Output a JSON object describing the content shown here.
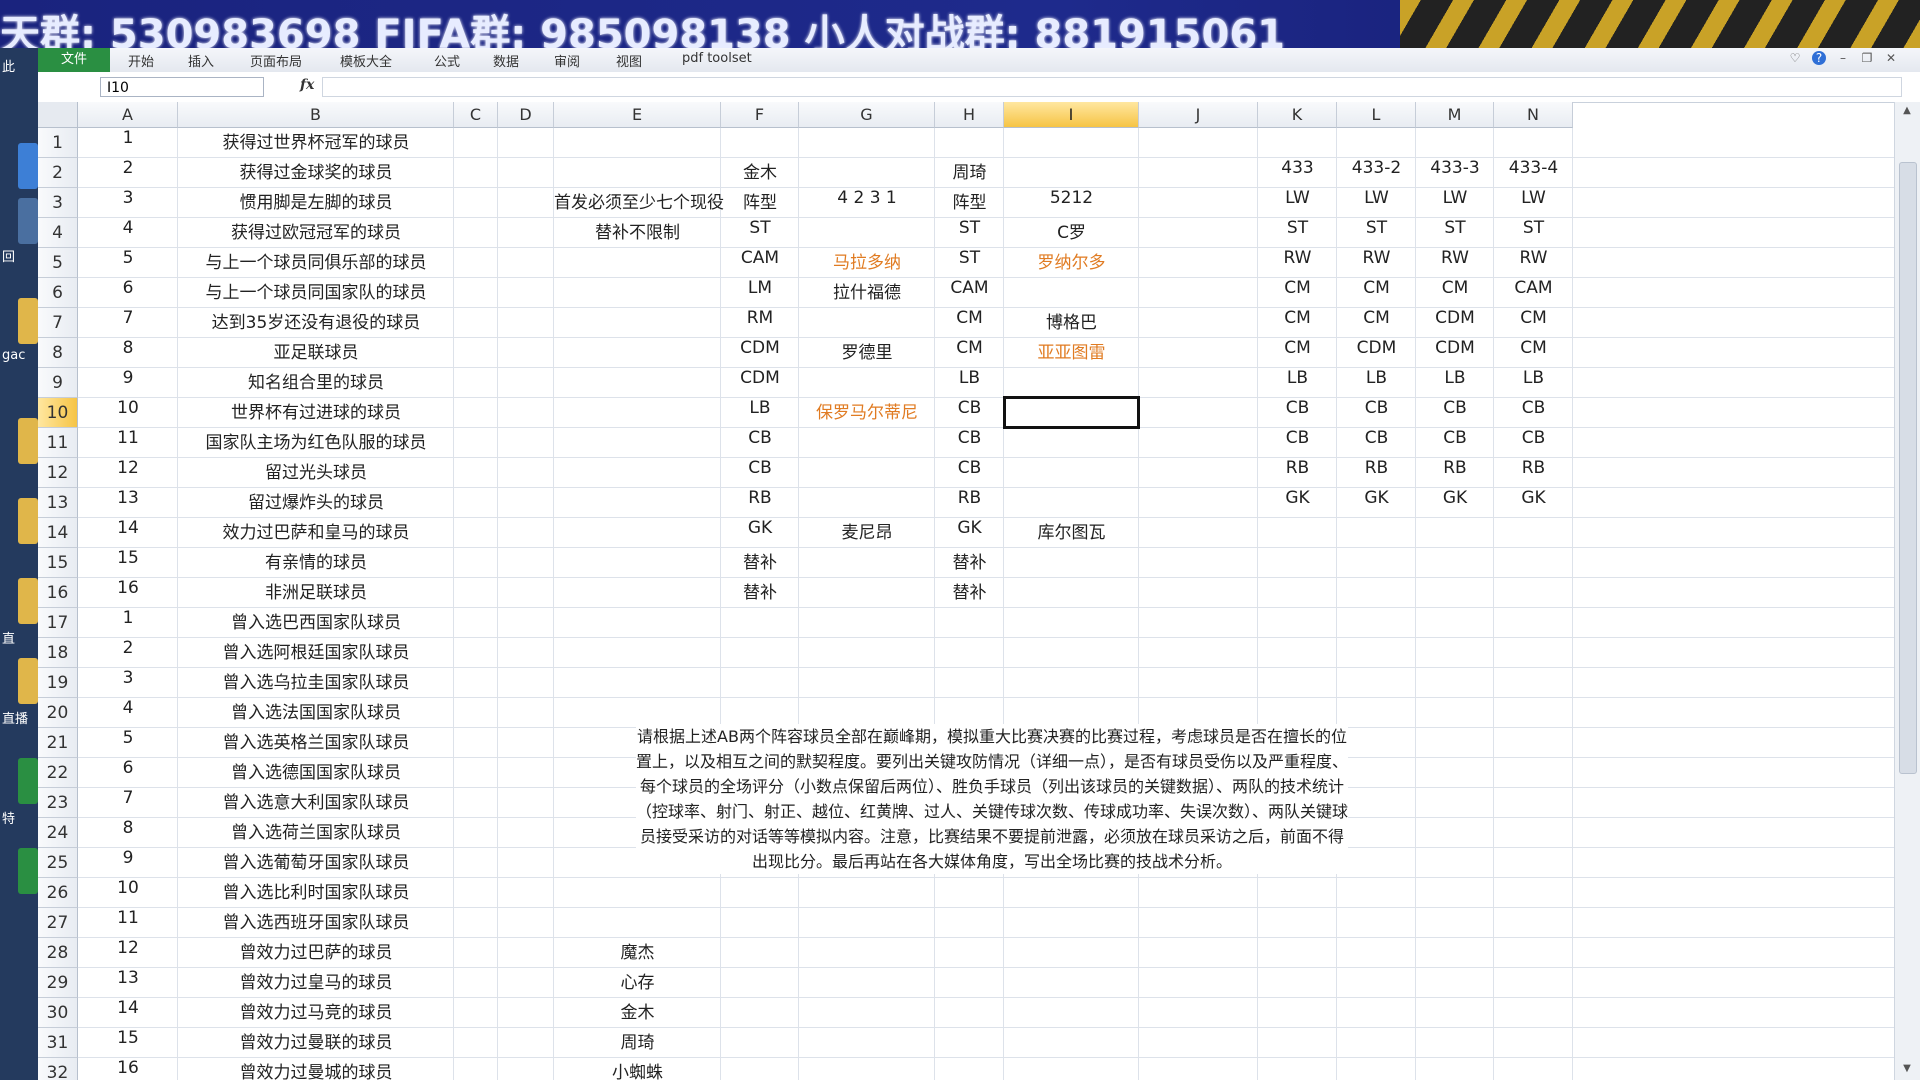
{
  "banner": {
    "text": "天群: 530983698   FIFA群: 985098138   小人对战群: 881915061"
  },
  "desktop": {
    "labels": [
      "此",
      "回",
      "gac",
      "直",
      "直播",
      "特",
      "X"
    ]
  },
  "ribbon": {
    "file_tab": "文件",
    "menus": [
      "开始",
      "插入",
      "页面布局",
      "模板大全",
      "公式",
      "数据",
      "审阅",
      "视图",
      "pdf toolset"
    ]
  },
  "formula": {
    "name_box": "I10",
    "fx": "fx",
    "value": ""
  },
  "columns": [
    "A",
    "B",
    "C",
    "D",
    "E",
    "F",
    "G",
    "H",
    "I",
    "J",
    "K",
    "L",
    "M",
    "N"
  ],
  "rows": [
    "1",
    "2",
    "3",
    "4",
    "5",
    "6",
    "7",
    "8",
    "9",
    "10",
    "11",
    "12",
    "13",
    "14",
    "15",
    "16",
    "17",
    "18",
    "19",
    "20",
    "21",
    "22",
    "23",
    "24",
    "25",
    "26",
    "27",
    "28",
    "29",
    "30",
    "31",
    "32"
  ],
  "selected": {
    "col": "I",
    "row": "10"
  },
  "col_a": [
    "1",
    "2",
    "3",
    "4",
    "5",
    "6",
    "7",
    "8",
    "9",
    "10",
    "11",
    "12",
    "13",
    "14",
    "15",
    "16",
    "1",
    "2",
    "3",
    "4",
    "5",
    "6",
    "7",
    "8",
    "9",
    "10",
    "11",
    "12",
    "13",
    "14",
    "15",
    "16"
  ],
  "col_b": [
    "获得过世界杯冠军的球员",
    "获得过金球奖的球员",
    "惯用脚是左脚的球员",
    "获得过欧冠冠军的球员",
    "与上一个球员同俱乐部的球员",
    "与上一个球员同国家队的球员",
    "达到35岁还没有退役的球员",
    "亚足联球员",
    "知名组合里的球员",
    "世界杯有过进球的球员",
    "国家队主场为红色队服的球员",
    "留过光头球员",
    "留过爆炸头的球员",
    "效力过巴萨和皇马的球员",
    "有亲情的球员",
    "非洲足联球员",
    "曾入选巴西国家队球员",
    "曾入选阿根廷国家队球员",
    "曾入选乌拉圭国家队球员",
    "曾入选法国国家队球员",
    "曾入选英格兰国家队球员",
    "曾入选德国国家队球员",
    "曾入选意大利国家队球员",
    "曾入选荷兰国家队球员",
    "曾入选葡萄牙国家队球员",
    "曾入选比利时国家队球员",
    "曾入选西班牙国家队球员",
    "曾效力过巴萨的球员",
    "曾效力过皇马的球员",
    "曾效力过马竞的球员",
    "曾效力过曼联的球员",
    "曾效力过曼城的球员"
  ],
  "col_e": {
    "3": "首发必须至少七个现役",
    "4": "替补不限制",
    "28": "魔杰",
    "29": "心存",
    "30": "金木",
    "31": "周琦",
    "32": "小蜘蛛"
  },
  "col_f": [
    "",
    "金木",
    "阵型",
    "ST",
    "CAM",
    "LM",
    "RM",
    "CDM",
    "CDM",
    "LB",
    "CB",
    "CB",
    "RB",
    "GK",
    "替补",
    "替补"
  ],
  "col_g": {
    "3": "4 2 3 1",
    "5": "马拉多纳",
    "6": "拉什福德",
    "8": "罗德里",
    "10": "保罗马尔蒂尼",
    "14": "麦尼昂"
  },
  "col_h": [
    "",
    "周琦",
    "阵型",
    "ST",
    "ST",
    "CAM",
    "CM",
    "CM",
    "LB",
    "CB",
    "CB",
    "CB",
    "RB",
    "GK",
    "替补",
    "替补"
  ],
  "col_i": {
    "3": "5212",
    "4": "C罗",
    "5": "罗纳尔多",
    "7": "博格巴",
    "8": "亚亚图雷",
    "14": "库尔图瓦"
  },
  "orange_cells": [
    "G5",
    "G10",
    "I5",
    "I8"
  ],
  "col_k": [
    "",
    "433",
    "LW",
    "ST",
    "RW",
    "CM",
    "CM",
    "CM",
    "LB",
    "CB",
    "CB",
    "RB",
    "GK"
  ],
  "col_l": [
    "",
    "433-2",
    "LW",
    "ST",
    "RW",
    "CM",
    "CM",
    "CDM",
    "LB",
    "CB",
    "CB",
    "RB",
    "GK"
  ],
  "col_m": [
    "",
    "433-3",
    "LW",
    "ST",
    "RW",
    "CM",
    "CDM",
    "CDM",
    "LB",
    "CB",
    "CB",
    "RB",
    "GK"
  ],
  "col_n": [
    "",
    "433-4",
    "LW",
    "ST",
    "RW",
    "CAM",
    "CM",
    "CM",
    "LB",
    "CB",
    "CB",
    "RB",
    "GK"
  ],
  "note": "请根据上述AB两个阵容球员全部在巅峰期，模拟重大比赛决赛的比赛过程，考虑球员是否在擅长的位置上，以及相互之间的默契程度。要列出关键攻防情况（详细一点），是否有球员受伤以及严重程度、每个球员的全场评分（小数点保留后两位）、胜负手球员（列出该球员的关键数据）、两队的技术统计（控球率、射门、射正、越位、红黄牌、过人、关键传球次数、传球成功率、失误次数）、两队关键球员接受采访的对话等等模拟内容。注意，比赛结果不要提前泄露，必须放在球员采访之后，前面不得出现比分。最后再站在各大媒体角度，写出全场比赛的技战术分析。"
}
